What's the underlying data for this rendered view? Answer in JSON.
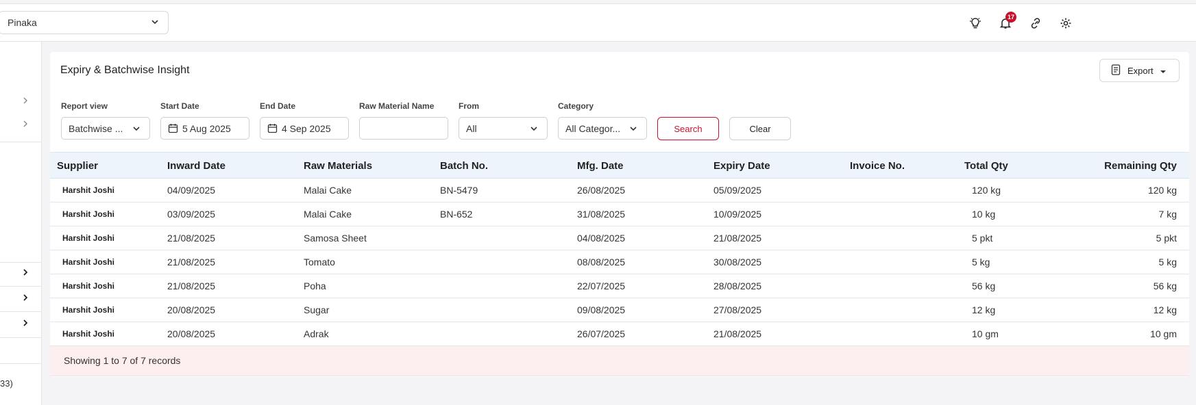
{
  "header": {
    "outlet_select": "Pinaka",
    "notification_count": "17",
    "icons": [
      "bulb-icon",
      "bell-icon",
      "link-icon",
      "gear-icon"
    ]
  },
  "sidebar": {
    "footer_text": "33)"
  },
  "report": {
    "title": "Expiry & Batchwise Insight",
    "export_label": "Export"
  },
  "filters": {
    "report_view": {
      "label": "Report view",
      "value": "Batchwise ..."
    },
    "start_date": {
      "label": "Start Date",
      "value": "5 Aug 2025"
    },
    "end_date": {
      "label": "End Date",
      "value": "4 Sep 2025"
    },
    "raw_material": {
      "label": "Raw Material Name",
      "value": ""
    },
    "from": {
      "label": "From",
      "value": "All"
    },
    "category": {
      "label": "Category",
      "value": "All Categor..."
    },
    "search_label": "Search",
    "clear_label": "Clear"
  },
  "table": {
    "columns": [
      "Supplier",
      "Inward Date",
      "Raw Materials",
      "Batch No.",
      "Mfg. Date",
      "Expiry Date",
      "Invoice No.",
      "Total Qty",
      "Remaining Qty"
    ],
    "rows": [
      [
        "Harshit Joshi",
        "04/09/2025",
        "Malai Cake",
        "BN-5479",
        "26/08/2025",
        "05/09/2025",
        "",
        "120 kg",
        "120 kg"
      ],
      [
        "Harshit Joshi",
        "03/09/2025",
        "Malai Cake",
        "BN-652",
        "31/08/2025",
        "10/09/2025",
        "",
        "10 kg",
        "7 kg"
      ],
      [
        "Harshit Joshi",
        "21/08/2025",
        "Samosa Sheet",
        "",
        "04/08/2025",
        "21/08/2025",
        "",
        "5 pkt",
        "5 pkt"
      ],
      [
        "Harshit Joshi",
        "21/08/2025",
        "Tomato",
        "",
        "08/08/2025",
        "30/08/2025",
        "",
        "5 kg",
        "5 kg"
      ],
      [
        "Harshit Joshi",
        "21/08/2025",
        "Poha",
        "",
        "22/07/2025",
        "28/08/2025",
        "",
        "56 kg",
        "56 kg"
      ],
      [
        "Harshit Joshi",
        "20/08/2025",
        "Sugar",
        "",
        "09/08/2025",
        "27/08/2025",
        "",
        "12 kg",
        "12 kg"
      ],
      [
        "Harshit Joshi",
        "20/08/2025",
        "Adrak",
        "",
        "26/07/2025",
        "21/08/2025",
        "",
        "10 gm",
        "10 gm"
      ]
    ],
    "footer": "Showing 1 to 7 of 7 records"
  }
}
